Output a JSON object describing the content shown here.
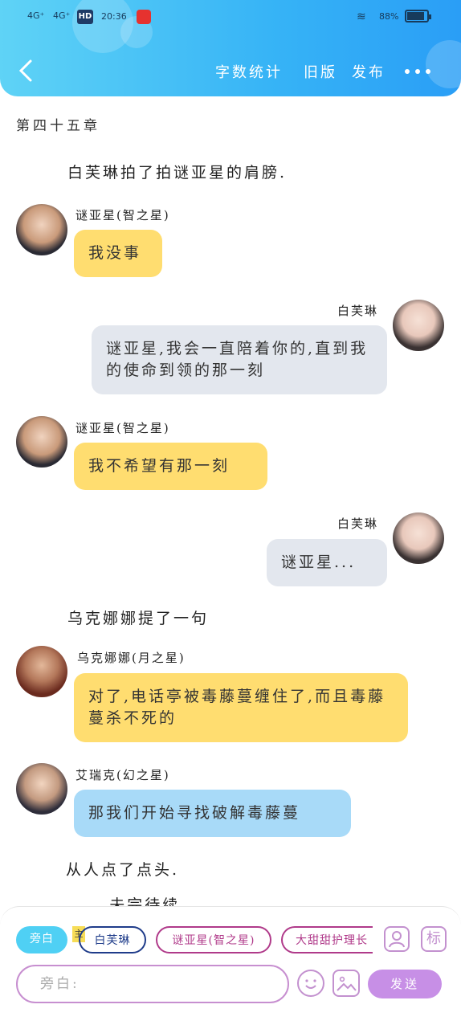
{
  "status_bar": {
    "network1": "4G⁺",
    "network2": "4G⁺",
    "hd": "HD",
    "time": "20:36",
    "battery": "88%"
  },
  "header": {
    "back_icon": "back-chevron-icon",
    "word_count": "字数统计",
    "old_version": "旧版",
    "publish": "发布",
    "more_icon": "more-dots-icon"
  },
  "chapter_title": "第四十五章",
  "items": [
    {
      "type": "narration",
      "text": "白芙琳拍了拍谜亚星的肩膀."
    },
    {
      "type": "message",
      "side": "left",
      "name": "谜亚星(智之星)",
      "text": "我没事",
      "color": "#ffdd70"
    },
    {
      "type": "message",
      "side": "right",
      "name": "白芙琳",
      "text": "谜亚星,我会一直陪着你的,直到我的使命到领的那一刻",
      "color": "#e3e7ee"
    },
    {
      "type": "message",
      "side": "left",
      "name": "谜亚星(智之星)",
      "text": "我不希望有那一刻",
      "color": "#ffdd70"
    },
    {
      "type": "message",
      "side": "right",
      "name": "白芙琳",
      "text": "谜亚星...",
      "color": "#e3e7ee"
    },
    {
      "type": "narration",
      "text": "乌克娜娜提了一句"
    },
    {
      "type": "message",
      "side": "left",
      "name": "乌克娜娜(月之星)",
      "text": "对了,电话亭被毒藤蔓缠住了,而且毒藤蔓杀不死的",
      "color": "#ffdd70"
    },
    {
      "type": "message",
      "side": "left",
      "name": "艾瑞克(幻之星)",
      "text": "那我们开始寻找破解毒藤蔓",
      "color": "#a8daf8"
    },
    {
      "type": "narration",
      "text": "从人点了点头."
    },
    {
      "type": "narration",
      "text": "......未完待续......"
    }
  ],
  "bottom_bar": {
    "chips": [
      "旁白",
      "白芙琳",
      "谜亚星(智之星)",
      "大甜甜护理长"
    ],
    "main_tag": "主",
    "input_placeholder": "旁白:",
    "send_label": "发送",
    "mark_label": "标",
    "icons": [
      "person-icon",
      "mark-icon",
      "emoji-icon",
      "image-icon"
    ]
  }
}
